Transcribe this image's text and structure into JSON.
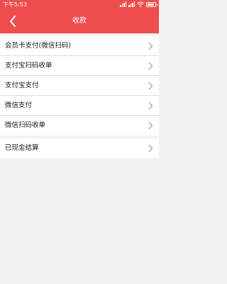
{
  "status_bar": {
    "time": "下午5:53"
  },
  "header": {
    "title": "收款"
  },
  "payment_methods": [
    {
      "label": "会员卡支付(微信扫码)"
    },
    {
      "label": "支付宝扫码收单"
    },
    {
      "label": "支付宝支付"
    },
    {
      "label": "微信支付"
    },
    {
      "label": "微信扫码收单"
    }
  ],
  "cash": {
    "label": "已现金结算"
  },
  "icons": {
    "back": "chevron-left-icon",
    "row_arrow": "chevron-right-icon"
  },
  "colors": {
    "accent": "#ef4d4d",
    "background": "#f2f2f2"
  }
}
